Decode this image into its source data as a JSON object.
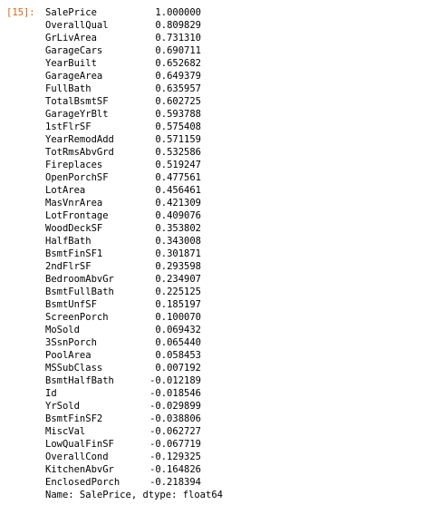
{
  "cell": {
    "prompt": "[15]:",
    "rows": [
      {
        "name": "SalePrice",
        "value": "1.000000"
      },
      {
        "name": "OverallQual",
        "value": "0.809829"
      },
      {
        "name": "GrLivArea",
        "value": "0.731310"
      },
      {
        "name": "GarageCars",
        "value": "0.690711"
      },
      {
        "name": "YearBuilt",
        "value": "0.652682"
      },
      {
        "name": "GarageArea",
        "value": "0.649379"
      },
      {
        "name": "FullBath",
        "value": "0.635957"
      },
      {
        "name": "TotalBsmtSF",
        "value": "0.602725"
      },
      {
        "name": "GarageYrBlt",
        "value": "0.593788"
      },
      {
        "name": "1stFlrSF",
        "value": "0.575408"
      },
      {
        "name": "YearRemodAdd",
        "value": "0.571159"
      },
      {
        "name": "TotRmsAbvGrd",
        "value": "0.532586"
      },
      {
        "name": "Fireplaces",
        "value": "0.519247"
      },
      {
        "name": "OpenPorchSF",
        "value": "0.477561"
      },
      {
        "name": "LotArea",
        "value": "0.456461"
      },
      {
        "name": "MasVnrArea",
        "value": "0.421309"
      },
      {
        "name": "LotFrontage",
        "value": "0.409076"
      },
      {
        "name": "WoodDeckSF",
        "value": "0.353802"
      },
      {
        "name": "HalfBath",
        "value": "0.343008"
      },
      {
        "name": "BsmtFinSF1",
        "value": "0.301871"
      },
      {
        "name": "2ndFlrSF",
        "value": "0.293598"
      },
      {
        "name": "BedroomAbvGr",
        "value": "0.234907"
      },
      {
        "name": "BsmtFullBath",
        "value": "0.225125"
      },
      {
        "name": "BsmtUnfSF",
        "value": "0.185197"
      },
      {
        "name": "ScreenPorch",
        "value": "0.100070"
      },
      {
        "name": "MoSold",
        "value": "0.069432"
      },
      {
        "name": "3SsnPorch",
        "value": "0.065440"
      },
      {
        "name": "PoolArea",
        "value": "0.058453"
      },
      {
        "name": "MSSubClass",
        "value": "0.007192"
      },
      {
        "name": "BsmtHalfBath",
        "value": "-0.012189"
      },
      {
        "name": "Id",
        "value": "-0.018546"
      },
      {
        "name": "YrSold",
        "value": "-0.029899"
      },
      {
        "name": "BsmtFinSF2",
        "value": "-0.038806"
      },
      {
        "name": "MiscVal",
        "value": "-0.062727"
      },
      {
        "name": "LowQualFinSF",
        "value": "-0.067719"
      },
      {
        "name": "OverallCond",
        "value": "-0.129325"
      },
      {
        "name": "KitchenAbvGr",
        "value": "-0.164826"
      },
      {
        "name": "EnclosedPorch",
        "value": "-0.218394"
      }
    ],
    "footer": "Name: SalePrice, dtype: float64"
  },
  "colors": {
    "prompt": "#d2691e",
    "text": "#000000",
    "background": "#ffffff"
  }
}
